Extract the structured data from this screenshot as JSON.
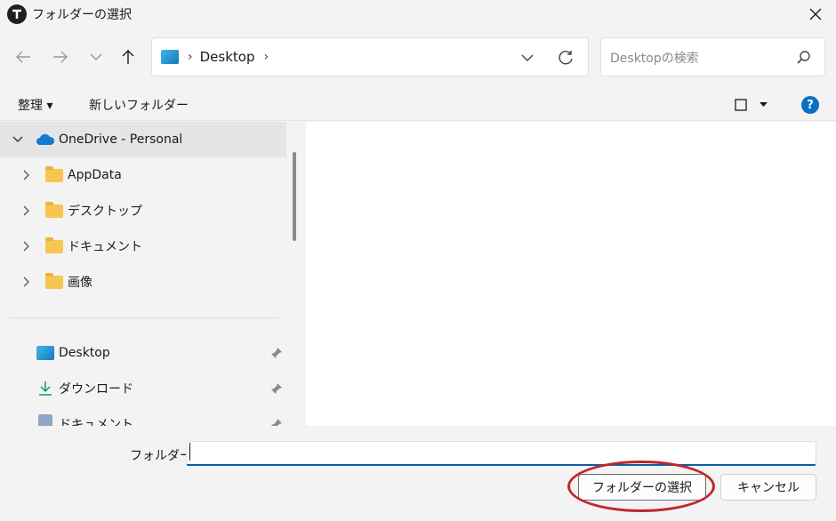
{
  "window": {
    "title": "フォルダーの選択",
    "app_icon": "app-logo-icon",
    "close_icon": "close-icon"
  },
  "nav": {
    "back_icon": "arrow-left-icon",
    "forward_icon": "arrow-right-icon",
    "recent_icon": "chevron-down-icon",
    "up_icon": "arrow-up-icon",
    "address": {
      "location_icon": "desktop-icon",
      "separator": "›",
      "crumb": "Desktop",
      "trailing_separator": "›"
    },
    "search": {
      "placeholder": "Desktopの検索"
    }
  },
  "commandbar": {
    "organize_label": "整理 ▾",
    "new_folder_label": "新しいフォルダー",
    "help_label": "?"
  },
  "tree": {
    "root": {
      "label": "OneDrive - Personal"
    },
    "items": [
      {
        "label": "AppData"
      },
      {
        "label": "デスクトップ"
      },
      {
        "label": "ドキュメント"
      },
      {
        "label": "画像"
      }
    ],
    "quick_access": [
      {
        "label": "Desktop"
      },
      {
        "label": "ダウンロード"
      },
      {
        "label": "ドキュメント"
      }
    ]
  },
  "bottom": {
    "folder_label": "フォルダー:",
    "folder_value": "",
    "select_button": "フォルダーの選択",
    "cancel_button": "キャンセル"
  },
  "colors": {
    "accent": "#0a5fa8",
    "highlight_ring": "#c0262c",
    "folder": "#f6c651"
  }
}
